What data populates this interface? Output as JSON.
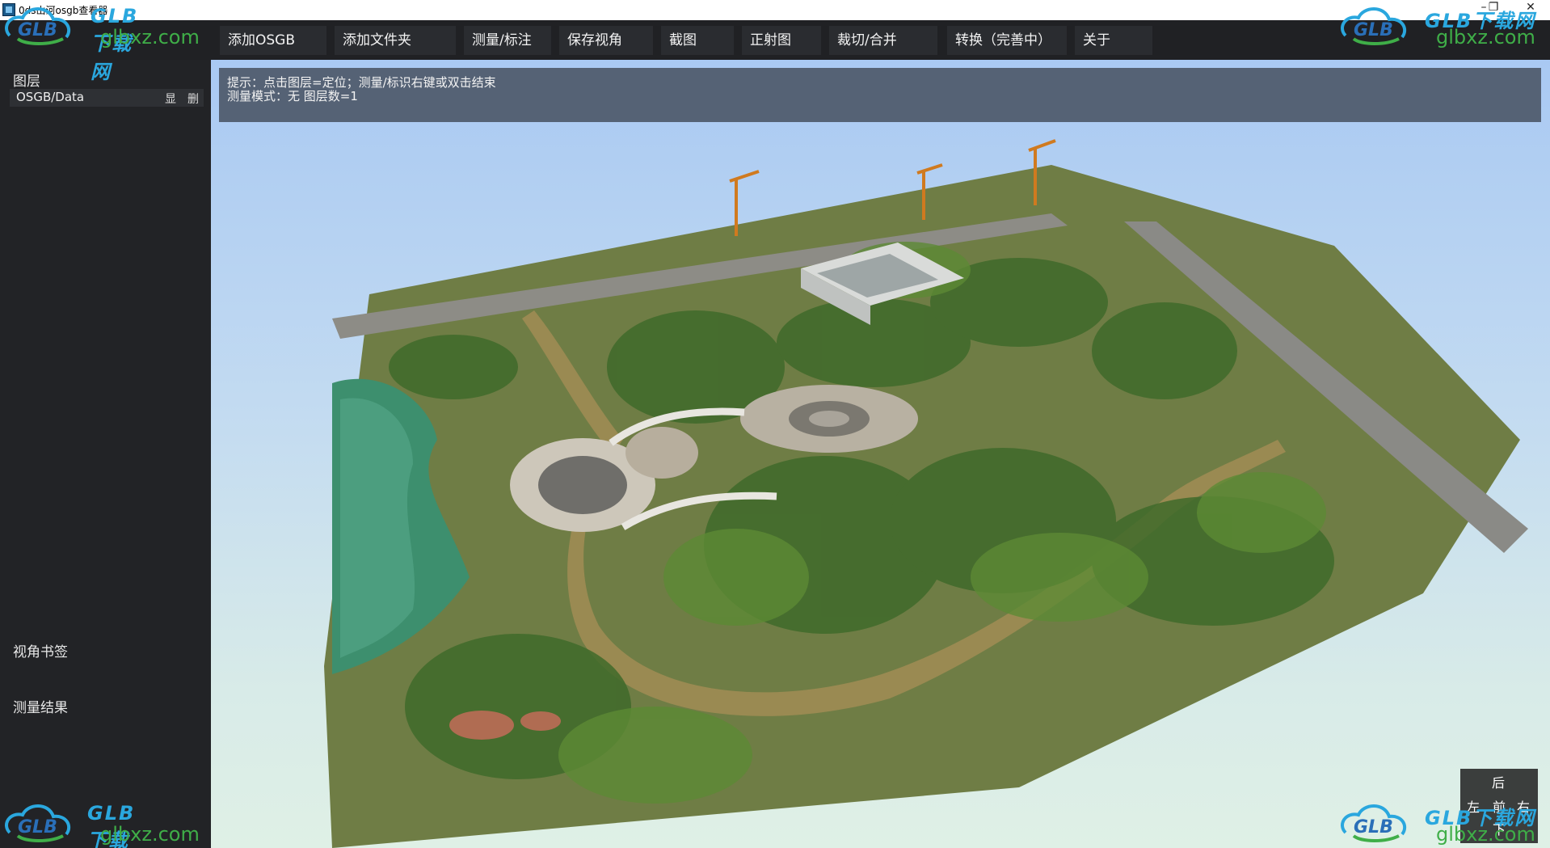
{
  "window": {
    "title": "0ds山河osgb查看器",
    "controls": {
      "minimize": "–",
      "maximize": "❐",
      "close": "✕"
    }
  },
  "menu": {
    "items": [
      {
        "id": "add-osgb",
        "label": "添加OSGB"
      },
      {
        "id": "add-folder",
        "label": "添加文件夹"
      },
      {
        "id": "measure",
        "label": "测量/标注"
      },
      {
        "id": "save-view",
        "label": "保存视角"
      },
      {
        "id": "screenshot",
        "label": "截图"
      },
      {
        "id": "ortho",
        "label": "正射图"
      },
      {
        "id": "clip-merge",
        "label": "裁切/合并"
      },
      {
        "id": "convert",
        "label": "转换（完善中）"
      },
      {
        "id": "about",
        "label": "关于"
      }
    ]
  },
  "watermark": {
    "brand": "GLB",
    "cn": "GLB下载网",
    "url": "glbxz.com"
  },
  "sidebar": {
    "layers_label": "图层",
    "layers": [
      {
        "name": "OSGB/Data",
        "show": "显",
        "delete": "删"
      }
    ],
    "bookmarks_label": "视角书签",
    "results_label": "测量结果"
  },
  "viewport": {
    "hint_line1": "提示：点击图层=定位；测量/标识右键或双击结束",
    "hint_line2": "测量模式：无   图层数=1"
  },
  "nav": {
    "back": "后",
    "left": "左",
    "center": "前",
    "right": "右",
    "down": "下"
  },
  "colors": {
    "menu_bg": "#202124",
    "sidebar_bg": "#222326",
    "hint_bg": "#505c6e",
    "sky_top": "#a9c9f3",
    "watermark_blue": "#2aa7de",
    "watermark_green": "#3fae48"
  }
}
